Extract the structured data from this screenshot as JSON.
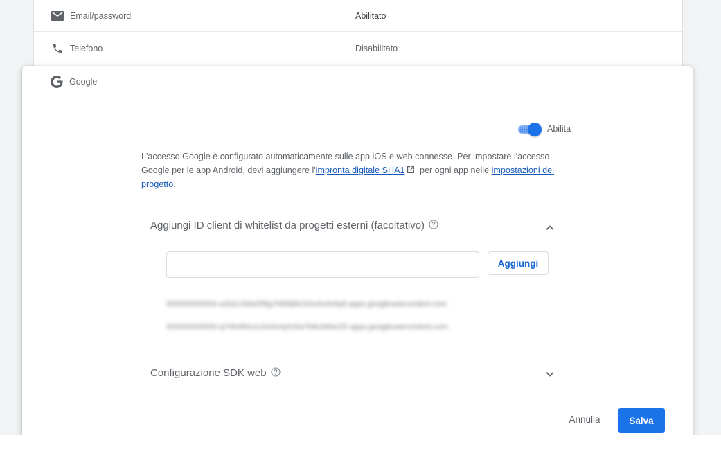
{
  "providers": [
    {
      "name": "Email/password",
      "icon": "mail-icon",
      "status": "Abilitato"
    },
    {
      "name": "Telefono",
      "icon": "phone-icon",
      "status": "Disabilitato"
    }
  ],
  "google": {
    "name": "Google",
    "icon": "google-icon",
    "toggle_label": "Abilita",
    "enabled": true,
    "description": {
      "part1": "L'accesso Google è configurato automaticamente sulle app iOS e web connesse. Per impostare l'accesso Google per le app Android, devi aggiungere l'",
      "link1": "impronta digitale SHA1",
      "part2": " per ogni app nelle ",
      "link2": "impostazioni del progetto",
      "part3": "."
    },
    "whitelist": {
      "title": "Aggiungi ID client di whitelist da progetti esterni (facoltativo)",
      "input_value": "",
      "input_placeholder": "",
      "add_label": "Aggiungi",
      "entries": [
        "000000000000-a1b2c3d4e5f6g7h8i9j0k1l2m3n4o5p6.apps.googleusercontent.com",
        "000000000000-q7r8s9t0u1v2w3x4y5z6a7b8c9d0e1f2.apps.googleusercontent.com"
      ]
    },
    "sdk_config": {
      "title": "Configurazione SDK web"
    },
    "cancel_label": "Annulla",
    "save_label": "Salva"
  },
  "colors": {
    "accent": "#1a73e8",
    "page_bg": "#f1f3f4",
    "text_secondary": "#5f6368"
  }
}
